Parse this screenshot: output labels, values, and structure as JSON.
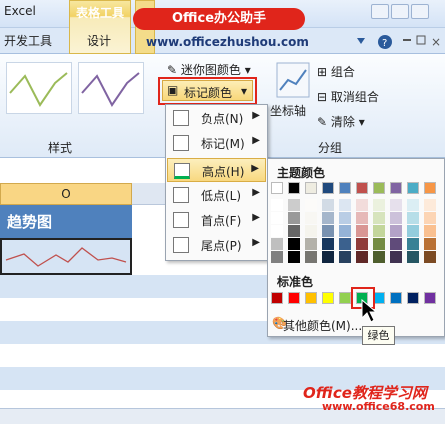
{
  "app_title": "Excel",
  "tabs": {
    "dev": "开发工具",
    "ctx_group": "表格工具",
    "design": "设计"
  },
  "banner": {
    "title": "Office办公助手",
    "url": "www.officezhushou.com"
  },
  "ribbon": {
    "spark_color": "迷你图颜色",
    "marker_color": "标记颜色",
    "axis": "坐标轴",
    "group": "组合",
    "ungroup": "取消组合",
    "clear": "清除",
    "style_group": "样式",
    "group_group": "分组"
  },
  "sheet": {
    "col_header": "O",
    "trend_title": "趋势图"
  },
  "submenu": [
    {
      "label": "负点(N)"
    },
    {
      "label": "标记(M)"
    },
    {
      "label": "高点(H)"
    },
    {
      "label": "低点(L)"
    },
    {
      "label": "首点(F)"
    },
    {
      "label": "尾点(P)"
    }
  ],
  "palette": {
    "theme_title": "主题颜色",
    "std_title": "标准色",
    "other": "其他颜色(M)...",
    "tooltip": "绿色",
    "theme_top": [
      "#ffffff",
      "#000000",
      "#eeece1",
      "#1f497d",
      "#4f81bd",
      "#c0504d",
      "#9bbb59",
      "#8064a2",
      "#4bacc6",
      "#f79646"
    ],
    "standard": [
      "#c00000",
      "#ff0000",
      "#ffc000",
      "#ffff00",
      "#92d050",
      "#00b050",
      "#00b0f0",
      "#0070c0",
      "#002060",
      "#7030a0"
    ]
  },
  "watermark": {
    "line1": "Office教程学习网",
    "line2": "www.office68.com"
  }
}
